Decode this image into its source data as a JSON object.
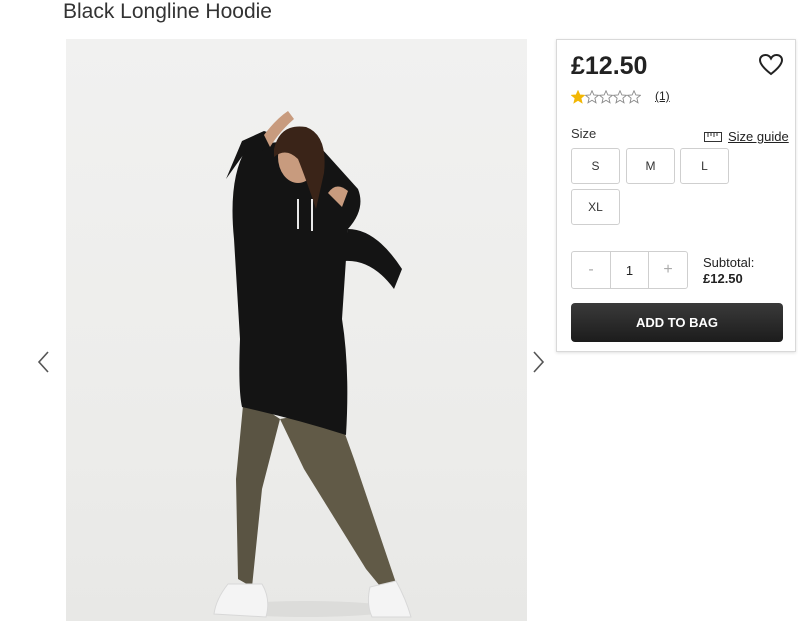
{
  "product": {
    "title": "Black Longline Hoodie",
    "price": "£12.50",
    "rating": 1,
    "rating_max": 5,
    "review_count": "(1)"
  },
  "size": {
    "label": "Size",
    "guide_label": "Size guide",
    "options": [
      "S",
      "M",
      "L",
      "XL"
    ]
  },
  "quantity": {
    "decrement": "-",
    "value": "1",
    "increment": "+"
  },
  "subtotal": {
    "label": "Subtotal:",
    "amount": "£12.50"
  },
  "actions": {
    "add_to_bag": "ADD TO BAG"
  },
  "colors": {
    "star_filled": "#f2b705",
    "button_dark": "#1c1c1c"
  },
  "icons": {
    "favourite": "heart-icon",
    "size_guide": "ruler-icon",
    "prev": "chevron-left-icon",
    "next": "chevron-right-icon"
  }
}
